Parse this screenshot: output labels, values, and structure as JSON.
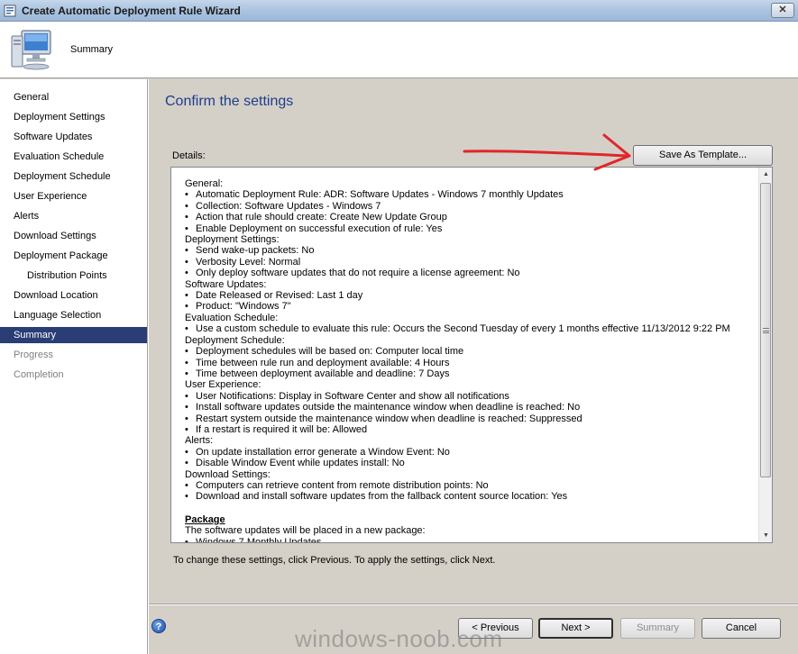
{
  "window": {
    "title": "Create Automatic Deployment Rule Wizard",
    "close_label": "✕"
  },
  "header": {
    "title": "Summary"
  },
  "sidebar": {
    "items": [
      {
        "label": "General",
        "state": "normal"
      },
      {
        "label": "Deployment Settings",
        "state": "normal"
      },
      {
        "label": "Software Updates",
        "state": "normal"
      },
      {
        "label": "Evaluation Schedule",
        "state": "normal"
      },
      {
        "label": "Deployment Schedule",
        "state": "normal"
      },
      {
        "label": "User Experience",
        "state": "normal"
      },
      {
        "label": "Alerts",
        "state": "normal"
      },
      {
        "label": "Download Settings",
        "state": "normal"
      },
      {
        "label": "Deployment Package",
        "state": "normal"
      },
      {
        "label": "Distribution Points",
        "state": "sub"
      },
      {
        "label": "Download Location",
        "state": "normal"
      },
      {
        "label": "Language Selection",
        "state": "normal"
      },
      {
        "label": "Summary",
        "state": "active"
      },
      {
        "label": "Progress",
        "state": "disabled"
      },
      {
        "label": "Completion",
        "state": "disabled"
      }
    ]
  },
  "main": {
    "title": "Confirm the settings",
    "details_label": "Details:",
    "save_template_label": "Save As Template...",
    "instructions": "To change these settings, click Previous. To apply the settings, click Next.",
    "details": {
      "sections": [
        {
          "heading": "General:",
          "items": [
            "Automatic Deployment Rule: ADR: Software Updates - Windows 7 monthly Updates",
            "Collection: Software Updates - Windows 7",
            "Action that rule should create: Create New Update Group",
            "Enable Deployment on successful execution of rule: Yes"
          ]
        },
        {
          "heading": "Deployment Settings:",
          "items": [
            "Send wake-up packets: No",
            "Verbosity Level: Normal",
            "Only deploy software updates that do not require a license agreement: No"
          ]
        },
        {
          "heading": "Software Updates:",
          "items": [
            "Date Released or Revised: Last 1 day",
            "Product: \"Windows 7\""
          ]
        },
        {
          "heading": "Evaluation Schedule:",
          "items": [
            "Use a custom schedule to evaluate this rule: Occurs the Second Tuesday of every 1 months effective 11/13/2012 9:22 PM"
          ]
        },
        {
          "heading": "Deployment Schedule:",
          "items": [
            "Deployment schedules will be based on: Computer local time",
            "Time between rule run and deployment available: 4 Hours",
            "Time between deployment available and deadline: 7 Days"
          ]
        },
        {
          "heading": "User Experience:",
          "items": [
            "User Notifications: Display in Software Center and show all notifications",
            "Install software updates outside the maintenance window when deadline is reached: No",
            "Restart system outside the maintenance window when deadline is reached: Suppressed",
            "If a restart is required it will be: Allowed"
          ]
        },
        {
          "heading": "Alerts:",
          "items": [
            "On update installation error generate a Window Event: No",
            "Disable Window Event while updates install: No"
          ]
        },
        {
          "heading": "Download Settings:",
          "items": [
            "Computers can retrieve content from remote distribution points: No",
            "Download and install software updates from the fallback content source location: Yes"
          ]
        }
      ],
      "package_heading": "Package",
      "package_line": "The software updates will be placed in a new package:",
      "package_item": "Windows 7 Monthly Updates"
    }
  },
  "footer": {
    "help_label": "?",
    "previous_label": "< Previous",
    "next_label": "Next >",
    "summary_label": "Summary",
    "cancel_label": "Cancel"
  },
  "watermark": "windows-noob.com",
  "annotation_color": "#e0262a"
}
